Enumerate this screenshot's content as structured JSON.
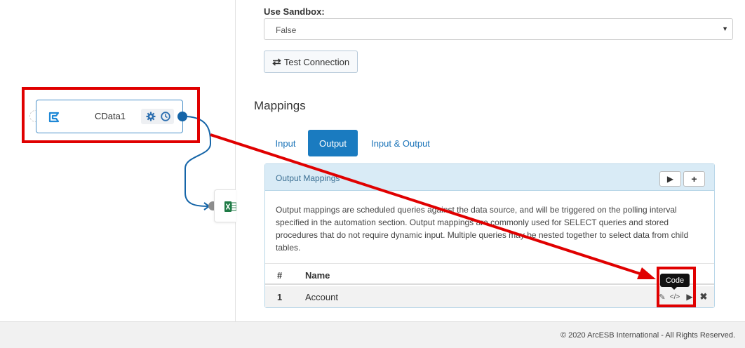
{
  "canvas": {
    "node": {
      "label": "CData1",
      "logo_icon": "cdata-logo-icon",
      "tools": [
        "gear-icon",
        "clock-icon"
      ]
    },
    "target_node": {
      "icon": "excel-icon"
    }
  },
  "settings": {
    "sandbox_label": "Use Sandbox:",
    "sandbox_value": "False",
    "test_connection_label": "Test Connection",
    "test_connection_icon": "exchange-icon"
  },
  "mappings": {
    "title": "Mappings",
    "tabs": [
      {
        "label": "Input",
        "active": false
      },
      {
        "label": "Output",
        "active": true
      },
      {
        "label": "Input & Output",
        "active": false
      }
    ],
    "card": {
      "title": "Output Mappings",
      "run_icon": "play-icon",
      "add_icon": "plus-icon",
      "description": "Output mappings are scheduled queries against the data source, and will be triggered on the polling interval specified in the automation section. Output mappings are commonly used for SELECT queries and stored procedures that do not require dynamic input. Multiple queries may be nested together to select data from child tables.",
      "columns": [
        "#",
        "Name"
      ],
      "rows": [
        {
          "num": "1",
          "name": "Account"
        }
      ],
      "row_actions": [
        "edit-icon",
        "code-icon",
        "play-icon",
        "close-icon"
      ]
    },
    "tooltip": "Code"
  },
  "colors": {
    "accent": "#1a7bc0",
    "annotation": "#e00000",
    "link": "#1a73b8"
  },
  "footer": {
    "copyright": "© 2020 ArcESB International - All Rights Reserved."
  }
}
